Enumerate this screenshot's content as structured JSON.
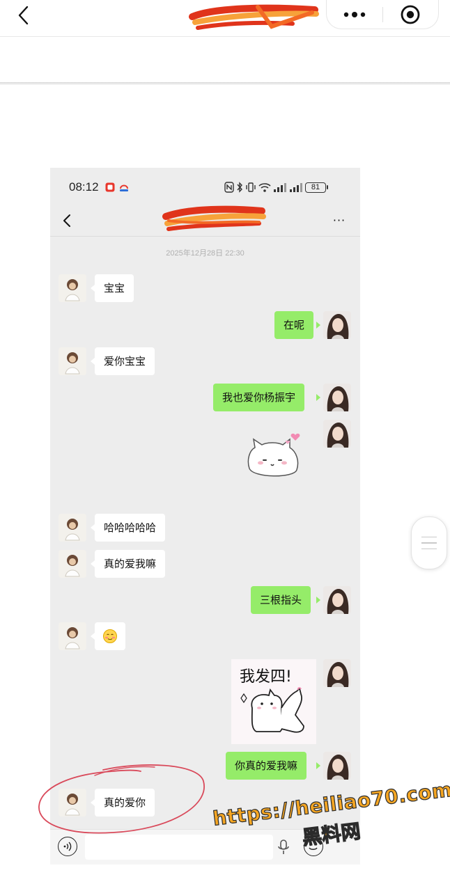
{
  "outer_bar": {
    "back_icon": "chevron-left-icon",
    "title_redacted": true,
    "capsule_more_icon": "more-dots-icon",
    "capsule_close_icon": "target-circle-icon"
  },
  "screenshot": {
    "status_bar": {
      "time": "08:12",
      "battery_level": "81",
      "icons": [
        "notification-icon",
        "nfc-icon",
        "bluetooth-icon",
        "vibrate-icon",
        "wifi-icon",
        "signal-icon",
        "signal-icon-2",
        "battery-icon"
      ]
    },
    "chat_header": {
      "back_icon": "chevron-left-icon",
      "title_redacted": true,
      "more_label": "···"
    },
    "timestamp": "2025年12月28日 22:30",
    "messages": [
      {
        "side": "in",
        "type": "text",
        "text": "宝宝"
      },
      {
        "side": "out",
        "type": "text",
        "text": "在呢"
      },
      {
        "side": "in",
        "type": "text",
        "text": "爱你宝宝"
      },
      {
        "side": "out",
        "type": "text",
        "text": "我也爱你杨振宇"
      },
      {
        "side": "out",
        "type": "sticker",
        "sticker": "white-cat-sticker"
      },
      {
        "side": "in",
        "type": "text",
        "text": "哈哈哈哈哈"
      },
      {
        "side": "in",
        "type": "text",
        "text": "真的爱我嘛"
      },
      {
        "side": "out",
        "type": "text",
        "text": "三根指头"
      },
      {
        "side": "in",
        "type": "emoji",
        "text": "☺"
      },
      {
        "side": "out",
        "type": "sticker",
        "sticker": "fight-cat-sticker",
        "text": "我发四!"
      },
      {
        "side": "out",
        "type": "text",
        "text": "你真的爱我嘛"
      },
      {
        "side": "in",
        "type": "text",
        "text": "真的爱你"
      }
    ],
    "input_bar": {
      "voice_icon": "voice-icon",
      "input_value": "",
      "mic_icon": "microphone-icon",
      "emoji_icon": "emoji-icon"
    }
  },
  "floating_handle_icon": "menu-lines-icon",
  "watermark": {
    "url": "https://heiliao70.com",
    "name": "黑料网"
  },
  "colors": {
    "chat_background": "#ededed",
    "outgoing_bubble": "#95ec69",
    "incoming_bubble": "#ffffff",
    "annotation_circle": "#d9495a",
    "watermark_fill": "#f5a623",
    "redaction": [
      "#e0341b",
      "#f7a23a"
    ]
  }
}
